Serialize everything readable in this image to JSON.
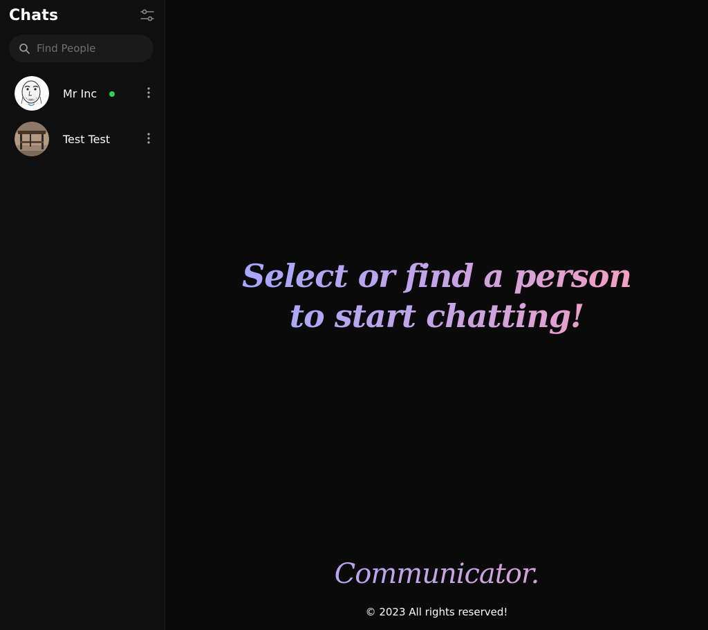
{
  "sidebar": {
    "title": "Chats",
    "filter_icon": "sliders-icon",
    "search": {
      "placeholder": "Find People",
      "value": ""
    },
    "chats": [
      {
        "name": "Mr Inc",
        "online": true,
        "avatar": "meme-face-avatar"
      },
      {
        "name": "Test Test",
        "online": false,
        "avatar": "table-photo-avatar"
      }
    ]
  },
  "main": {
    "empty_message": "Select or find a person to start chatting!",
    "brand": "Communicator.",
    "copyright": "© 2023 All rights reserved!"
  },
  "colors": {
    "background": "#0b0a0b",
    "sidebar": "#0f0f0f",
    "online": "#2fd05a",
    "gradient_start": "#a5a8ff",
    "gradient_end": "#f59fc0"
  }
}
